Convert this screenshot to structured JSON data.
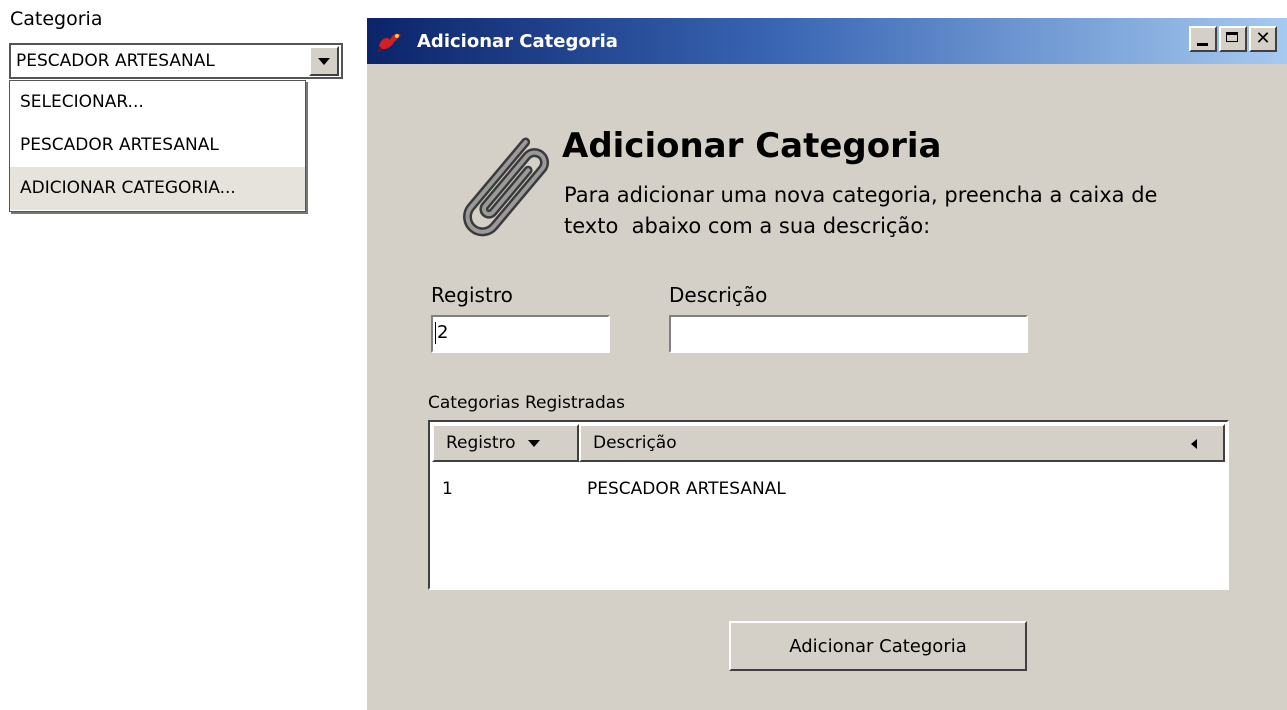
{
  "combo": {
    "label": "Categoria",
    "selected": "PESCADOR ARTESANAL",
    "options": [
      "SELECIONAR...",
      "PESCADOR ARTESANAL",
      "ADICIONAR CATEGORIA..."
    ]
  },
  "dialog": {
    "title": "Adicionar Categoria",
    "close_glyph": "✕",
    "heading": "Adicionar Categoria",
    "intro_line1": "Para adicionar uma nova categoria, preencha a caixa de",
    "intro_line2": "texto  abaixo com a sua descrição:",
    "registro_label": "Registro",
    "registro_value": "2",
    "descricao_label": "Descrição",
    "descricao_value": "",
    "table": {
      "caption": "Categorias Registradas",
      "columns": [
        "Registro",
        "Descrição"
      ],
      "rows": [
        [
          "1",
          "PESCADOR ARTESANAL"
        ]
      ]
    },
    "add_button_label": "Adicionar Categoria"
  },
  "colors": {
    "titlebar_start": "#0b246a",
    "titlebar_end": "#a6caf0",
    "dialog_bg": "#d4d0c8"
  }
}
